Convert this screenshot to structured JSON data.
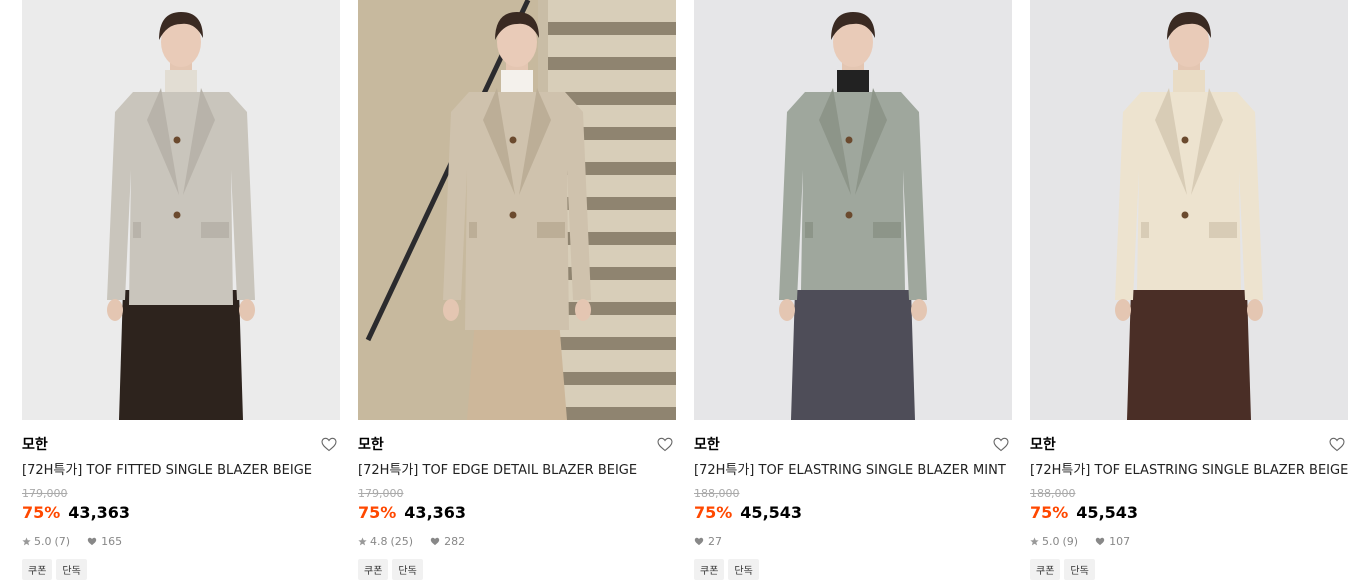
{
  "products": [
    {
      "brand": "모한",
      "title": "[72H특가] TOF FITTED SINGLE BLAZER BEIGE",
      "original_price": "179,000",
      "discount": "75%",
      "price": "43,363",
      "rating": "5.0",
      "reviews": "(7)",
      "likes": "165",
      "tags": [
        "쿠폰",
        "단독"
      ],
      "colors": {
        "bg": "#ebebeb",
        "jacket": "#c9c5bc",
        "lapel": "#b8b3aa",
        "pants": "#2d231d",
        "inner": "#e2ddd3"
      }
    },
    {
      "brand": "모한",
      "title": "[72H특가] TOF EDGE DETAIL BLAZER BEIGE",
      "original_price": "179,000",
      "discount": "75%",
      "price": "43,363",
      "rating": "4.8",
      "reviews": "(25)",
      "likes": "282",
      "tags": [
        "쿠폰",
        "단독"
      ],
      "colors": {
        "bg": "#c9bda6",
        "jacket": "#cfc2ad",
        "lapel": "#bcae97",
        "pants": "#cdb79a",
        "inner": "#f4f1ec"
      }
    },
    {
      "brand": "모한",
      "title": "[72H특가] TOF ELASTRING SINGLE BLAZER MINT",
      "original_price": "188,000",
      "discount": "75%",
      "price": "45,543",
      "rating": "",
      "reviews": "",
      "likes": "27",
      "tags": [
        "쿠폰",
        "단독"
      ],
      "colors": {
        "bg": "#e6e6e8",
        "jacket": "#9fa79d",
        "lapel": "#8d9589",
        "pants": "#4e4d58",
        "inner": "#222222"
      }
    },
    {
      "brand": "모한",
      "title": "[72H특가] TOF ELASTRING SINGLE BLAZER BEIGE",
      "original_price": "188,000",
      "discount": "75%",
      "price": "45,543",
      "rating": "5.0",
      "reviews": "(9)",
      "likes": "107",
      "tags": [
        "쿠폰",
        "단독"
      ],
      "colors": {
        "bg": "#e5e5e7",
        "jacket": "#ede3cf",
        "lapel": "#d8ccb6",
        "pants": "#4a2e26",
        "inner": "#e9dcc5"
      }
    }
  ],
  "icons": {
    "heart": "heart-outline-icon",
    "star": "star-icon",
    "like": "heart-filled-icon"
  },
  "accent_color": "#ff4800"
}
